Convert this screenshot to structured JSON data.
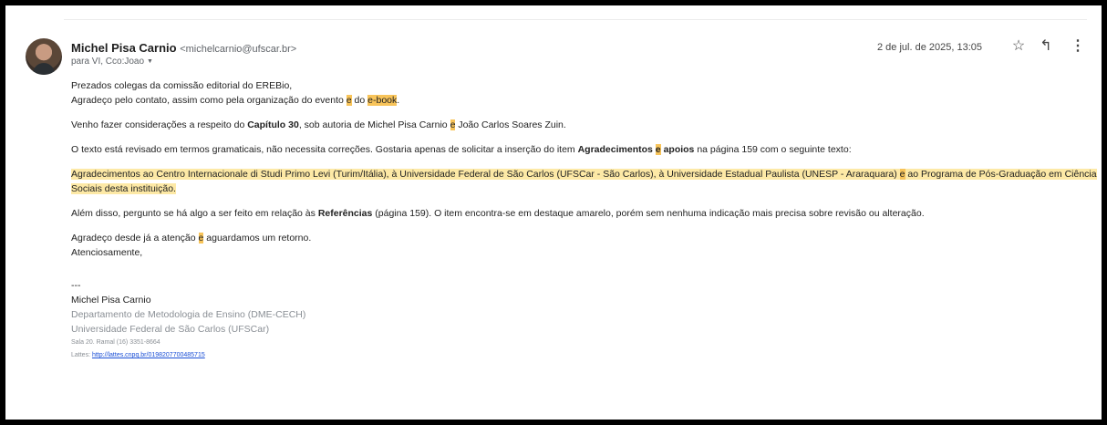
{
  "email": {
    "sender_name": "Michel Pisa Carnio",
    "sender_email": "<michelcarnio@ufscar.br>",
    "recipients": "para VI, Cco:Joao",
    "date": "2 de jul. de 2025, 13:05",
    "icons": {
      "star": "star-icon",
      "reply": "reply-icon",
      "more": "more-vert-icon"
    }
  },
  "body": {
    "p1a": "Prezados colegas da comissão editorial do EREBio,",
    "p1b_1": "Agradeço pelo contato, assim como pela organização do evento ",
    "p1b_e": "e",
    "p1b_2": " do ",
    "p1b_ebook": "e-book",
    "p1b_3": ".",
    "p2_1": "Venho fazer considerações a respeito do ",
    "p2_cap": "Capítulo 30",
    "p2_2": ", sob autoria de Michel Pisa Carnio ",
    "p2_e": "e",
    "p2_3": " João Carlos Soares Zuin.",
    "p3_1": "O texto está revisado em termos gramaticais, não necessita correções. Gostaria apenas de solicitar a inserção do item ",
    "p3_agr": "Agradecimentos",
    "p3_e": "e",
    "p3_apoios": "apoios",
    "p3_2": " na página 159 com o seguinte texto:",
    "p4_1": "Agradecimentos ao Centro Internacionale di Studi Primo Levi (Turim/Itália), à Universidade Federal de São Carlos (UFSCar - São Carlos), à Universidade Estadual Paulista (UNESP - Araraquara) ",
    "p4_e": "e",
    "p4_2": " ao Programa de Pós-Graduação em Ciência Sociais desta instituição.",
    "p5_1": "Além disso, pergunto se há algo a ser feito em relação às ",
    "p5_ref": "Referências",
    "p5_2": " (página 159). O item encontra-se em destaque amarelo, porém sem nenhuma indicação mais precisa sobre revisão ou alteração.",
    "p6_1": "Agradeço desde já a atenção ",
    "p6_e": "e",
    "p6_2": " aguardamos um retorno.",
    "p7": "Atenciosamente,"
  },
  "signature": {
    "dashes": "---",
    "name": "Michel Pisa Carnio",
    "dept": "Departamento de Metodologia de Ensino (DME-CECH)",
    "univ": "Universidade Federal de São Carlos (UFSCar)",
    "room": "Sala 20. Ramal (16) 3351-8664",
    "lattes_label": "Lattes: ",
    "lattes_url": "http://lattes.cnpq.br/0198207700485715"
  },
  "colors": {
    "highlight_light": "#fde9a6",
    "highlight_strong": "#f8c45a",
    "link": "#1a4fd6"
  }
}
